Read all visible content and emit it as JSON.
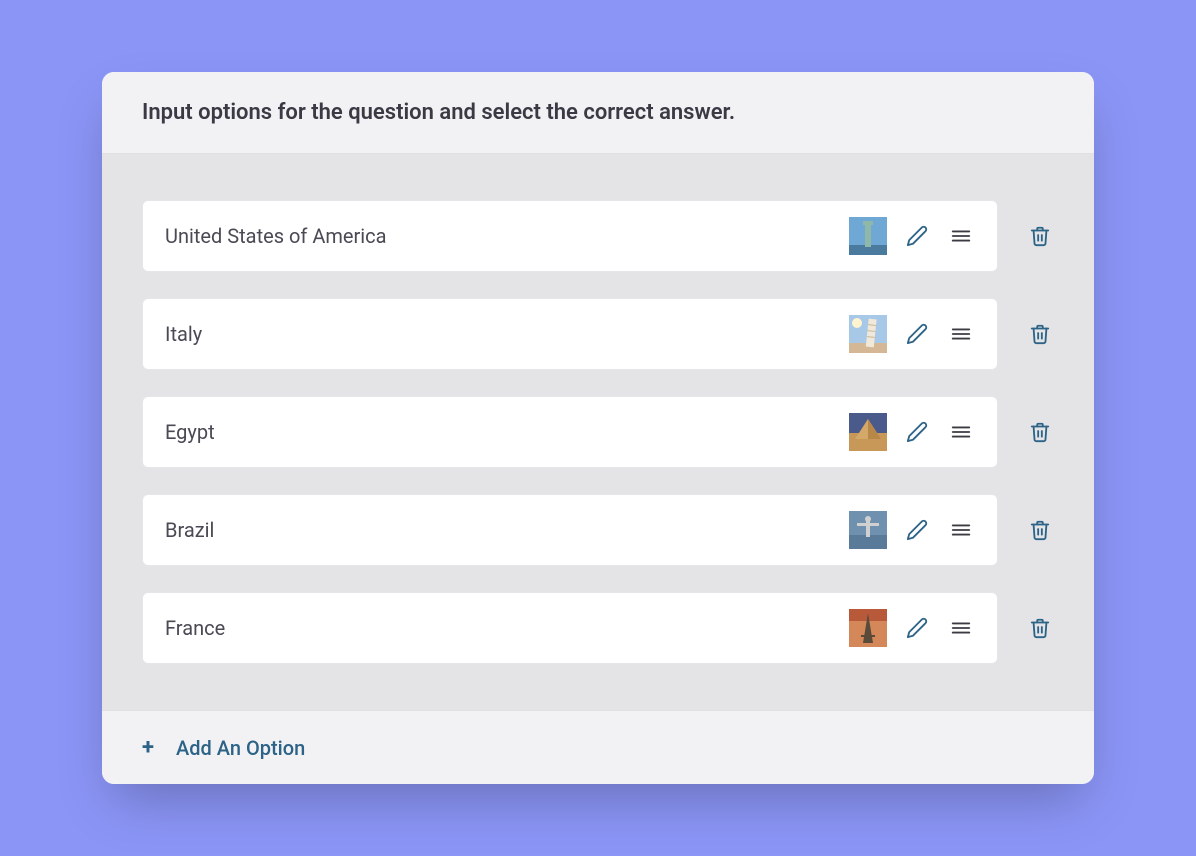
{
  "header": {
    "title": "Input options for the question and select the correct answer."
  },
  "options": [
    {
      "label": "United States of America",
      "thumb": "statue-of-liberty"
    },
    {
      "label": "Italy",
      "thumb": "leaning-tower"
    },
    {
      "label": "Egypt",
      "thumb": "pyramids"
    },
    {
      "label": "Brazil",
      "thumb": "statue-rio"
    },
    {
      "label": "France",
      "thumb": "eiffel-tower"
    }
  ],
  "footer": {
    "add_label": "Add An Option"
  }
}
